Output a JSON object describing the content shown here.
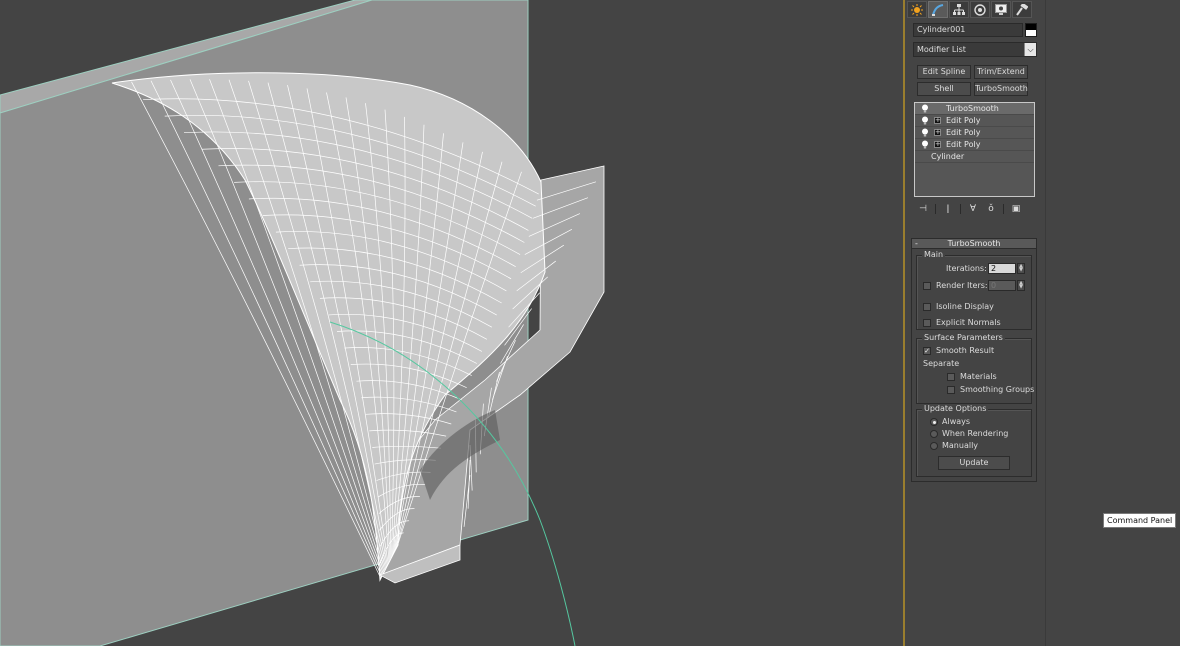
{
  "command_panel": {
    "tabs": [
      {
        "name": "create-tab",
        "icon": "sun-star-icon"
      },
      {
        "name": "modify-tab",
        "icon": "modify-curve-icon"
      },
      {
        "name": "hierarchy-tab",
        "icon": "hierarchy-icon"
      },
      {
        "name": "motion-tab",
        "icon": "motion-circle-icon"
      },
      {
        "name": "display-tab",
        "icon": "display-monitor-icon"
      },
      {
        "name": "utilities-tab",
        "icon": "hammer-icon"
      }
    ],
    "object_name": "Cylinder001",
    "modifier_list": {
      "label": "Modifier List",
      "dropdown_glyph": "⌵"
    },
    "modifier_buttons": {
      "edit_spline": "Edit Spline",
      "trim_extend": "Trim/Extend",
      "shell": "Shell",
      "turbosmooth": "TurboSmooth"
    },
    "stack": [
      {
        "label": "TurboSmooth",
        "has_bulb": true,
        "has_plus": false
      },
      {
        "label": "Edit Poly",
        "has_bulb": true,
        "has_plus": true
      },
      {
        "label": "Edit Poly",
        "has_bulb": true,
        "has_plus": true
      },
      {
        "label": "Edit Poly",
        "has_bulb": true,
        "has_plus": true
      },
      {
        "label": "Cylinder",
        "has_bulb": false,
        "has_plus": false
      }
    ],
    "stack_tools": [
      {
        "name": "pin-stack-icon",
        "glyph": "⊣"
      },
      {
        "name": "show-end-result-icon",
        "glyph": "ǀ"
      },
      {
        "name": "make-unique-icon",
        "glyph": "∀"
      },
      {
        "name": "remove-modifier-icon",
        "glyph": "ǒ"
      },
      {
        "name": "configure-modifier-sets-icon",
        "glyph": "▣"
      }
    ],
    "rollout": {
      "title": "TurboSmooth",
      "collapse_glyph": "-",
      "main": {
        "title": "Main",
        "iterations_label": "Iterations:",
        "iterations_value": "2",
        "render_iters_label": "Render Iters:",
        "render_iters_value": "0",
        "render_iters_checked": false,
        "isoline_label": "Isoline Display",
        "isoline_checked": false,
        "explicit_normals_label": "Explicit Normals",
        "explicit_normals_checked": false
      },
      "surface": {
        "title": "Surface Parameters",
        "smooth_result_label": "Smooth Result",
        "smooth_result_checked": true,
        "separate_label": "Separate",
        "materials_label": "Materials",
        "materials_checked": false,
        "smoothing_groups_label": "Smoothing Groups",
        "smoothing_groups_checked": false
      },
      "update": {
        "title": "Update Options",
        "options": [
          "Always",
          "When Rendering",
          "Manually"
        ],
        "selected": "Always",
        "update_button": "Update"
      }
    }
  },
  "tooltip": "Command Panel",
  "colors": {
    "viewport_bg": "#444444",
    "wall_face": "#8e8e8e",
    "wall_edge": "#9dcfc0",
    "selection_edge": "#55c8a0",
    "wireframe": "#ffffff",
    "panel_border_accent": "#9a7e2e"
  }
}
